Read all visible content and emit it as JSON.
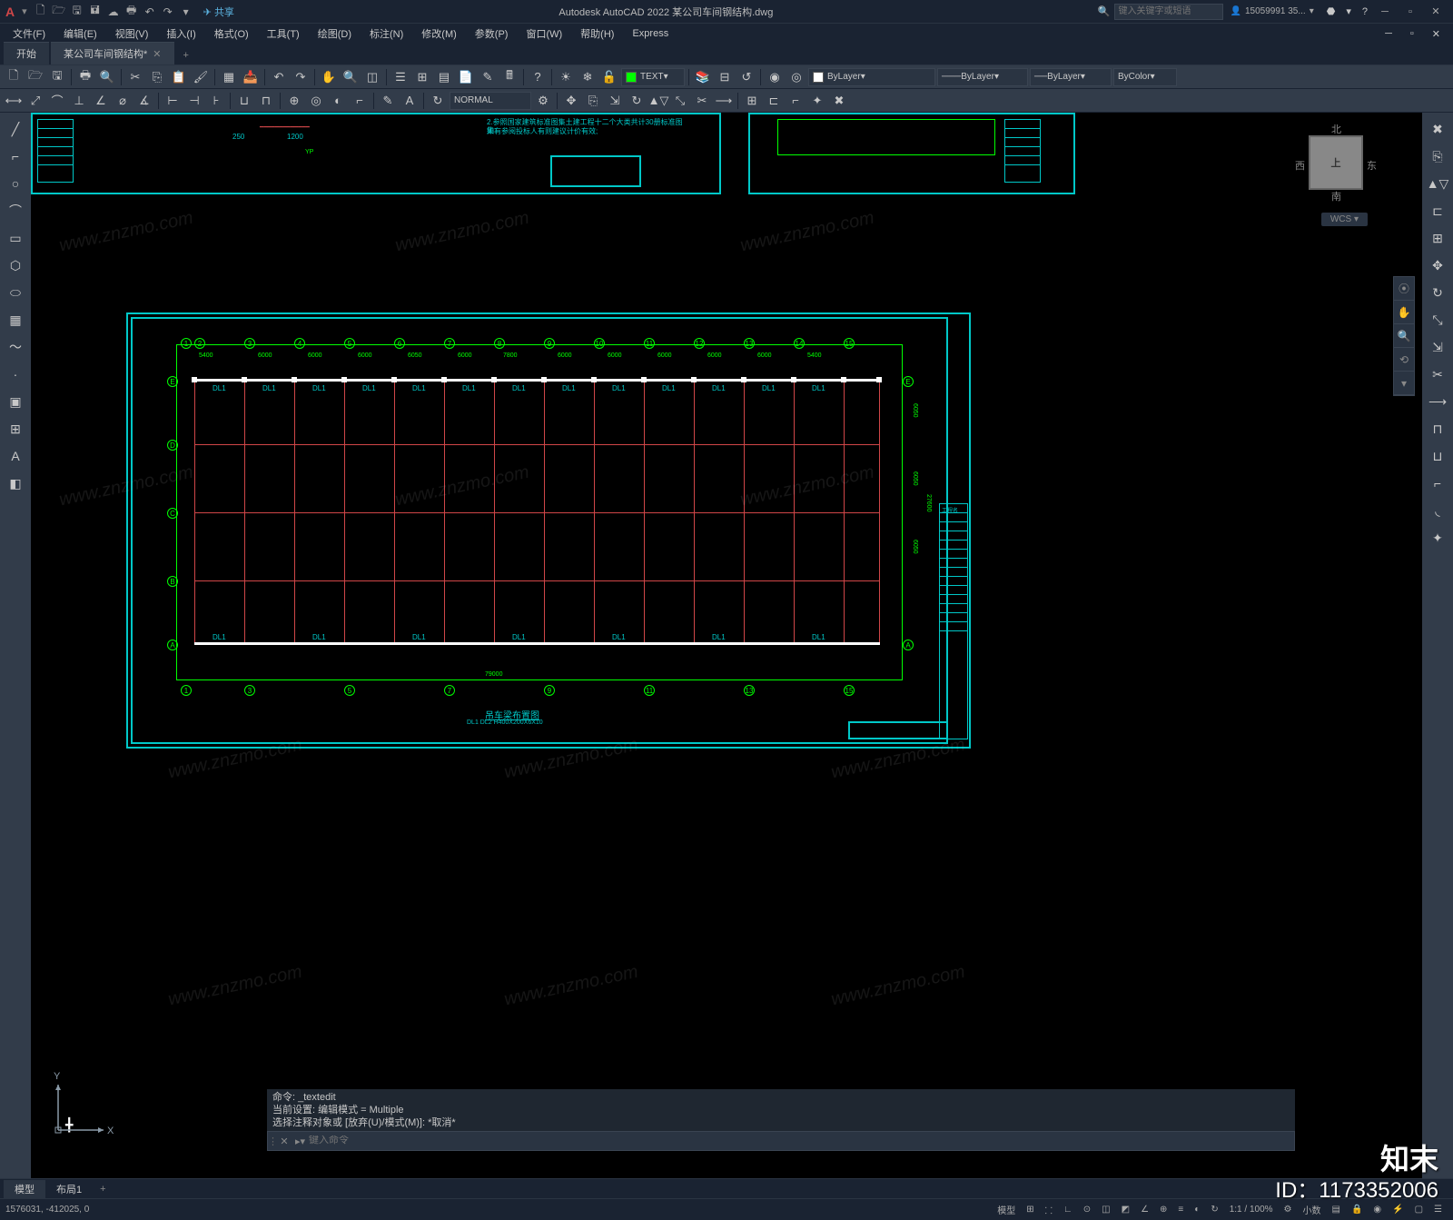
{
  "titlebar": {
    "logo": "A",
    "share": "共享",
    "title": "Autodesk AutoCAD 2022  某公司车间钢结构.dwg",
    "search_placeholder": "键入关键字或短语",
    "user": "15059991 35...",
    "help_icon": "?"
  },
  "menubar": [
    "文件(F)",
    "编辑(E)",
    "视图(V)",
    "插入(I)",
    "格式(O)",
    "工具(T)",
    "绘图(D)",
    "标注(N)",
    "修改(M)",
    "参数(P)",
    "窗口(W)",
    "帮助(H)",
    "Express"
  ],
  "filetabs": {
    "start": "开始",
    "active": "某公司车间钢结构*"
  },
  "toolbar1": {
    "text_style": "TEXT",
    "layer": "ByLayer",
    "lineweight": "ByLayer",
    "linetype": "ByLayer",
    "plot_style": "ByColor"
  },
  "toolbar2": {
    "dim_style": "NORMAL"
  },
  "viewcube": {
    "face": "上",
    "n": "北",
    "s": "南",
    "e": "东",
    "w": "西",
    "wcs": "WCS ▾"
  },
  "ucs": {
    "x": "X",
    "y": "Y"
  },
  "command": {
    "hist1": "命令: _textedit",
    "hist2": "当前设置: 编辑模式 = Multiple",
    "hist3": "选择注释对象或 [放弃(U)/模式(M)]: *取消*",
    "prompt": "▸▾",
    "placeholder": "键入命令"
  },
  "layouttabs": {
    "model": "模型",
    "layout1": "布局1"
  },
  "statusbar": {
    "coords": "1576031, -412025, 0",
    "model": "模型",
    "scale": "1:1 / 100%",
    "decimal": "小数"
  },
  "drawing": {
    "title_main": "吊车梁布置图",
    "title_sub": "DL1 DL2 H400X200X6X10",
    "note1": "2.参照国家建筑标准图集土建工程十二个大类共计30册标准图集;",
    "note2": "如有参阅投标人有则建议计价有效;",
    "note_yp": "YP",
    "dim_5400": "5400",
    "dim_6000": "6000",
    "dim_6050": "6050",
    "dim_7800": "7800",
    "dim_79000": "79000",
    "dim_27600": "27600",
    "dim_250": "250",
    "dim_1200": "1200",
    "dl_label": "DL1",
    "grid_letters": [
      "A",
      "B",
      "C",
      "D",
      "E"
    ],
    "grid_numbers": [
      "1",
      "2",
      "3",
      "4",
      "5",
      "6",
      "7",
      "8",
      "9",
      "10",
      "11",
      "12",
      "13",
      "14",
      "15"
    ],
    "titleblock": "工程名"
  },
  "watermark": {
    "logo": "知末",
    "id": "ID：1173352006",
    "url": "www.znzmo.com"
  }
}
